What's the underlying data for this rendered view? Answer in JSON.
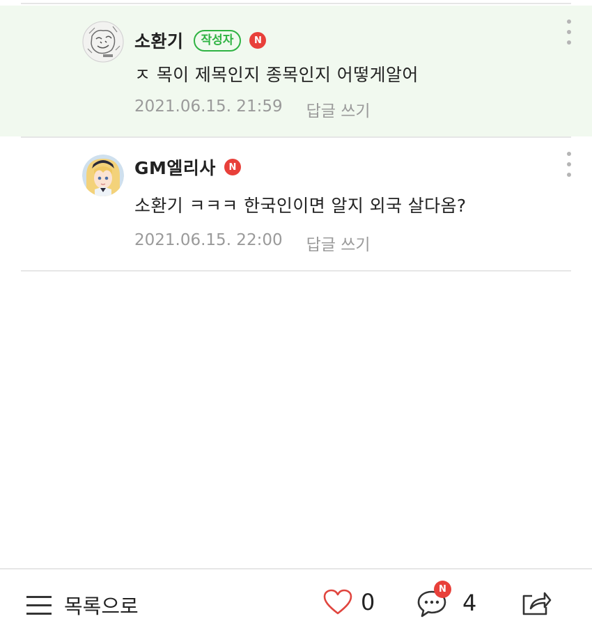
{
  "comments": [
    {
      "nickname": "소환기",
      "author_badge": "작성자",
      "new_badge": "N",
      "content": "ㅈ 목이 제목인지 종목인지 어떻게알어",
      "timestamp": "2021.06.15. 21:59",
      "reply_label": "답글 쓰기",
      "highlighted": true
    },
    {
      "nickname": "GM엘리사",
      "new_badge": "N",
      "content": "소환기 ㅋㅋㅋ 한국인이면 알지 외국 살다옴?",
      "timestamp": "2021.06.15. 22:00",
      "reply_label": "답글 쓰기",
      "highlighted": false
    }
  ],
  "bottom_bar": {
    "list_label": "목록으로",
    "like_count": "0",
    "comment_count": "4",
    "comment_new_badge": "N"
  },
  "colors": {
    "highlight_bg": "#f1f9ef",
    "author_badge": "#2fb343",
    "new_badge": "#e8403a",
    "like_heart": "#e0453e",
    "meta_text": "#9a9a9a"
  },
  "icons": {
    "menu": "list-menu-icon",
    "like": "heart-icon",
    "comment": "speech-bubble-icon",
    "share": "share-icon",
    "more": "more-vertical-icon"
  }
}
